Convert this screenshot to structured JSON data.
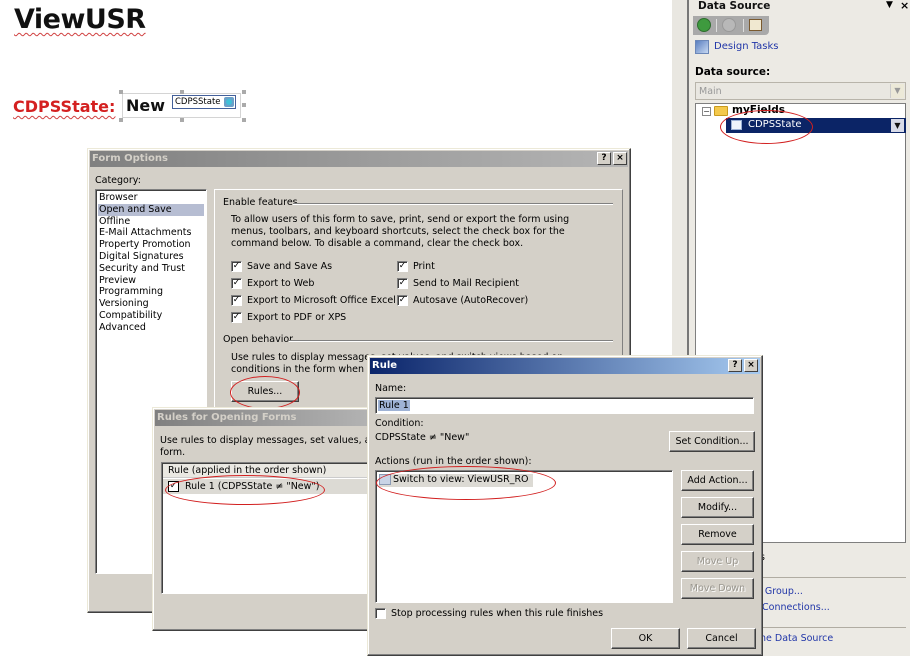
{
  "form_canvas": {
    "view_title": "ViewUSR",
    "field_label": "CDPSState:",
    "field_value": "New",
    "field_binding_tag": "CDPSState"
  },
  "task_pane": {
    "title": "Data Source",
    "dropdown_glyph": "▼",
    "close_glyph": "×",
    "nav_buttons": [
      "back",
      "forward",
      "home"
    ],
    "design_tasks_link": "Design Tasks",
    "data_source_label": "Data source:",
    "data_source_value": "Main",
    "tree": {
      "root": "myFields",
      "selected_field": "CDPSState"
    },
    "bottom_fragments": {
      "partial_1": "s",
      "link_group": "r Group...",
      "link_connections": "Connections...",
      "link_data_source": "he Data Source"
    }
  },
  "form_options_dialog": {
    "title": "Form Options",
    "help_glyph": "?",
    "close_glyph": "×",
    "category_label": "Category:",
    "categories": [
      "Browser",
      "Open and Save",
      "Offline",
      "E-Mail Attachments",
      "Property Promotion",
      "Digital Signatures",
      "Security and Trust",
      "Preview",
      "Programming",
      "Versioning",
      "Compatibility",
      "Advanced"
    ],
    "selected_category": "Open and Save",
    "enable_features": {
      "group_label": "Enable features",
      "description": "To allow users of this form to save, print, send or export the form using menus, toolbars, and keyboard shortcuts, select the check box for the command below.  To disable a command, clear the check box.",
      "checkboxes": [
        {
          "label": "Save and Save As",
          "checked": true
        },
        {
          "label": "Export to Web",
          "checked": true
        },
        {
          "label": "Export to Microsoft Office Excel",
          "checked": true
        },
        {
          "label": "Export to PDF or XPS",
          "checked": true
        },
        {
          "label": "Print",
          "checked": true
        },
        {
          "label": "Send to Mail Recipient",
          "checked": true
        },
        {
          "label": "Autosave (AutoRecover)",
          "checked": true
        }
      ]
    },
    "open_behavior": {
      "group_label": "Open behavior",
      "description_line1": "Use rules to display messages, set values, and switch views based on",
      "description_line2": "conditions in the form when the",
      "rules_button": "Rules..."
    }
  },
  "rules_for_opening_dialog": {
    "title": "Rules for Opening Forms",
    "description_line1": "Use rules to display messages, set values, and",
    "description_line2": "form.",
    "list_header": "Rule (applied in the order shown)",
    "rules": [
      {
        "label": "Rule 1 (CDPSState ≠ \"New\")",
        "checked": true
      }
    ]
  },
  "rule_dialog": {
    "title": "Rule",
    "help_glyph": "?",
    "close_glyph": "×",
    "name_label": "Name:",
    "name_value": "Rule 1",
    "condition_label": "Condition:",
    "condition_value": "CDPSState ≠ \"New\"",
    "set_condition_button": "Set Condition...",
    "actions_label": "Actions (run in the order shown):",
    "actions": [
      "Switch to view: ViewUSR_RO"
    ],
    "buttons": {
      "add_action": "Add Action...",
      "modify": "Modify...",
      "remove": "Remove",
      "move_up": "Move Up",
      "move_down": "Move Down"
    },
    "stop_processing_label": "Stop processing rules when this rule finishes",
    "stop_processing_checked": false,
    "ok": "OK",
    "cancel": "Cancel"
  },
  "colors": {
    "annotation_red": "#d22020",
    "selection_navy": "#0b2466",
    "link_blue": "#2136a8",
    "dialog_face": "#d4d0c8"
  }
}
